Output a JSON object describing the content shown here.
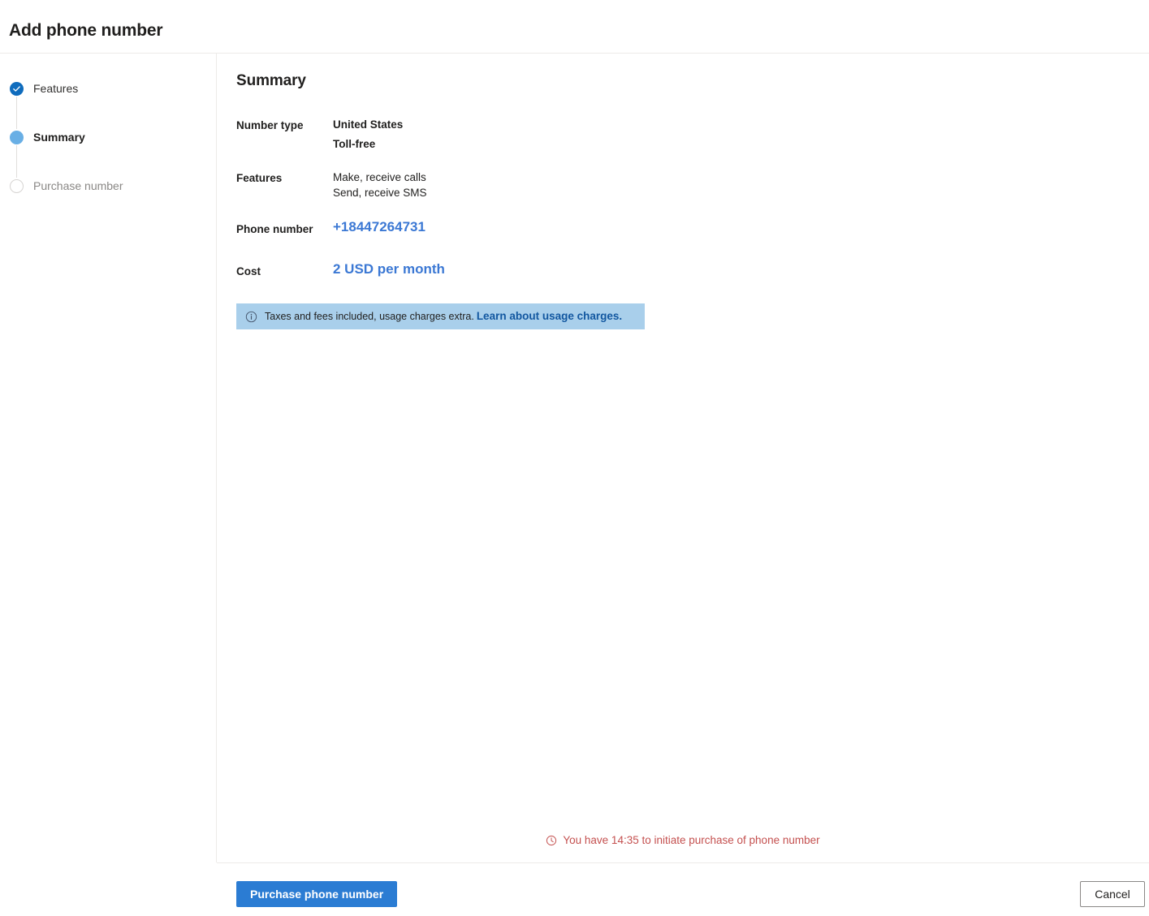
{
  "header": {
    "title": "Add phone number"
  },
  "stepper": {
    "steps": [
      {
        "label": "Features",
        "state": "done",
        "marker_icon": "check-circle-icon"
      },
      {
        "label": "Summary",
        "state": "current",
        "marker_icon": "filled-circle-icon"
      },
      {
        "label": "Purchase number",
        "state": "pending",
        "marker_icon": "empty-circle-icon"
      }
    ]
  },
  "content": {
    "title": "Summary",
    "rows": [
      {
        "label": "Number type",
        "values": [
          "United States",
          "Toll-free"
        ]
      },
      {
        "label": "Features",
        "values": [
          "Make, receive calls",
          "Send, receive SMS"
        ]
      },
      {
        "label": "Phone number",
        "emphasis": "+18447264731"
      },
      {
        "label": "Cost",
        "emphasis": "2 USD per month"
      }
    ],
    "banner": {
      "icon": "info-icon",
      "text": "Taxes and fees included, usage charges extra.",
      "link_label": "Learn about usage charges.",
      "background": "#a9cfeb",
      "link_color": "#1257a0"
    }
  },
  "countdown": {
    "icon": "clock-icon",
    "text": "You have 14:35 to initiate purchase of phone number",
    "color": "#c4504f"
  },
  "footer": {
    "primary_label": "Purchase phone number",
    "secondary_label": "Cancel",
    "primary_color": "#2b7cd3"
  },
  "colors": {
    "accent": "#0f6cbd",
    "link": "#3b78d4",
    "divider": "#edebe9"
  }
}
